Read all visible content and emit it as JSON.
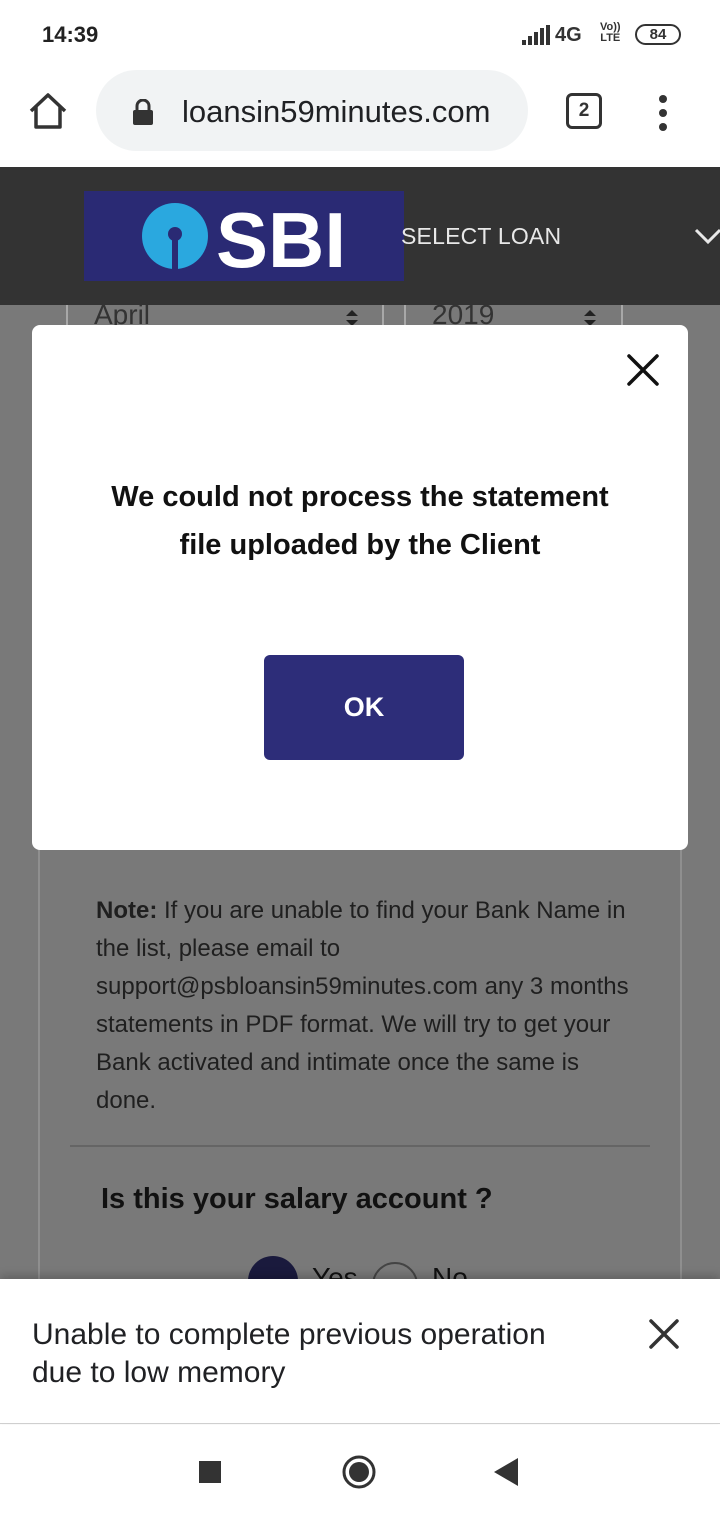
{
  "status_bar": {
    "time": "14:39",
    "network": "4G",
    "volte_top": "Vo))",
    "volte_bottom": "LTE",
    "battery": "84"
  },
  "browser": {
    "url": "loansin59minutes.com",
    "tab_count": "2"
  },
  "site": {
    "logo_text": "SBI",
    "nav_label": "SELECT LOAN",
    "brand_color": "#2a2a74"
  },
  "form": {
    "month_value": "April",
    "year_value": "2019",
    "note_label": "Note:",
    "note_text": " If you are unable to find your Bank Name in the list, please email to support@psbloansin59minutes.com any 3 months statements in PDF format. We will try to get your Bank activated and intimate once the same is done.",
    "salary_question": "Is this your salary account ?",
    "radio_yes": "Yes",
    "radio_no": "No"
  },
  "modal": {
    "message": "We could not process the statement file uploaded by the Client",
    "ok_label": "OK"
  },
  "snackbar": {
    "message": "Unable to complete previous operation due to low memory"
  },
  "icons": {
    "home": "home-icon",
    "lock": "lock-icon",
    "menu": "more-vert-icon",
    "close": "close-icon",
    "recents": "recents-icon",
    "nav_home": "nav-home-icon",
    "back": "back-icon"
  }
}
